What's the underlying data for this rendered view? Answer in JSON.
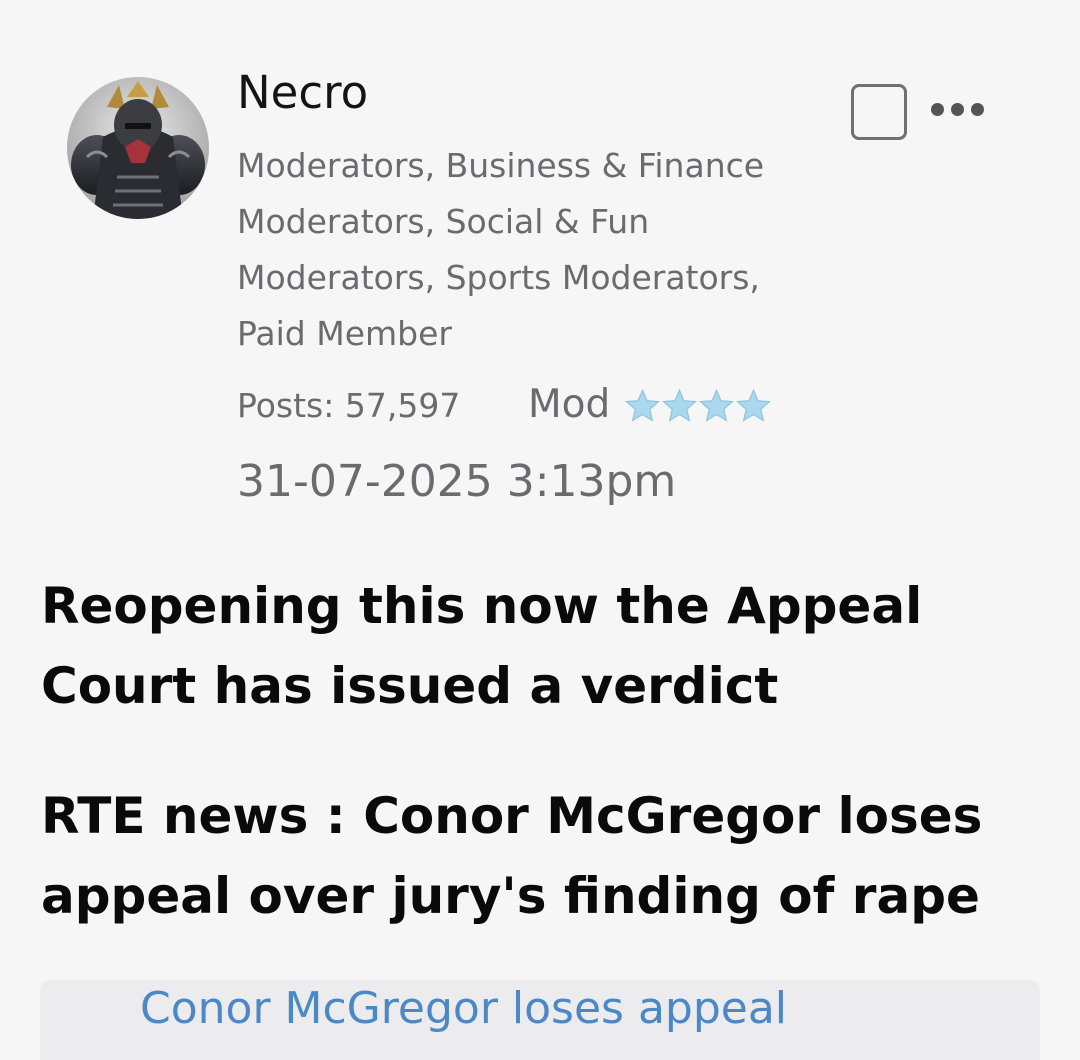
{
  "post": {
    "author": {
      "name": "Necro",
      "avatar_icon": "armored-knight-avatar",
      "groups": [
        "Moderators, Business & Finance",
        "Moderators, Social & Fun",
        "Moderators, Sports Moderators,",
        "Paid Member"
      ],
      "posts_label": "Posts: 57,597",
      "rank_label": "Mod",
      "rank_stars": 4,
      "star_color": "#a9d8ef"
    },
    "timestamp": "31-07-2025 3:13pm",
    "actions": {
      "select_checkbox_icon": "checkbox-icon",
      "more_icon": "more-options-icon"
    },
    "body": {
      "paragraphs": [
        [
          "Reopening this now the Appeal",
          "Court has issued a verdict"
        ],
        [
          "RTE news : Conor McGregor loses",
          "appeal over jury's finding of rape"
        ]
      ]
    },
    "link_preview": {
      "text": "Conor McGregor loses appeal"
    }
  }
}
